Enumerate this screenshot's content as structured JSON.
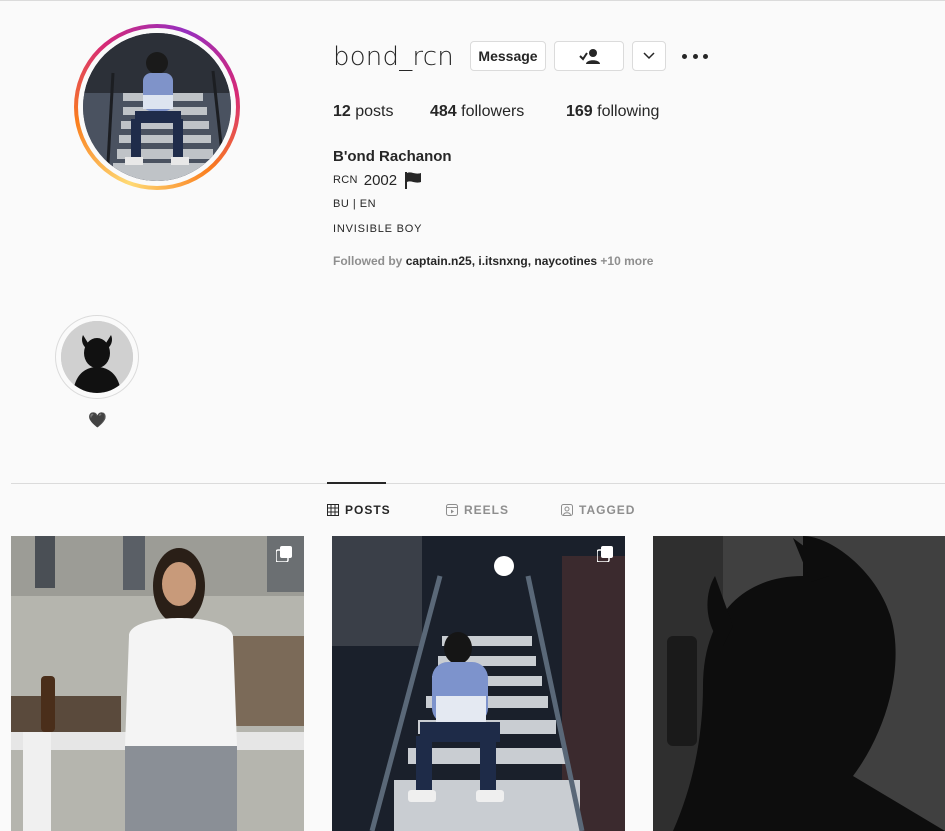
{
  "profile": {
    "username": "bond_rcn",
    "message_label": "Message",
    "stats": {
      "posts_count": "12",
      "posts_label": "posts",
      "followers_count": "484",
      "followers_label": "followers",
      "following_count": "169",
      "following_label": "following"
    },
    "full_name": "B'ond Rachanon",
    "bio": {
      "line1_small": "RCN",
      "line1_year": "2002",
      "line2": "BU | EN",
      "line3": "INVISIBLE BOY"
    },
    "followed_by": {
      "prefix": "Followed by",
      "names": "captain.n25, i.itsnxng, naycotines",
      "more": "+10 more"
    }
  },
  "highlight": {
    "label": "🖤"
  },
  "tabs": [
    {
      "label": "POSTS",
      "icon": "grid-icon",
      "active": true
    },
    {
      "label": "REELS",
      "icon": "reels-icon",
      "active": false
    },
    {
      "label": "TAGGED",
      "icon": "tagged-icon",
      "active": false
    }
  ],
  "colors": {
    "text": "#262626",
    "muted": "#8e8e8e",
    "border": "#dbdbdb",
    "background": "#fafafa"
  }
}
